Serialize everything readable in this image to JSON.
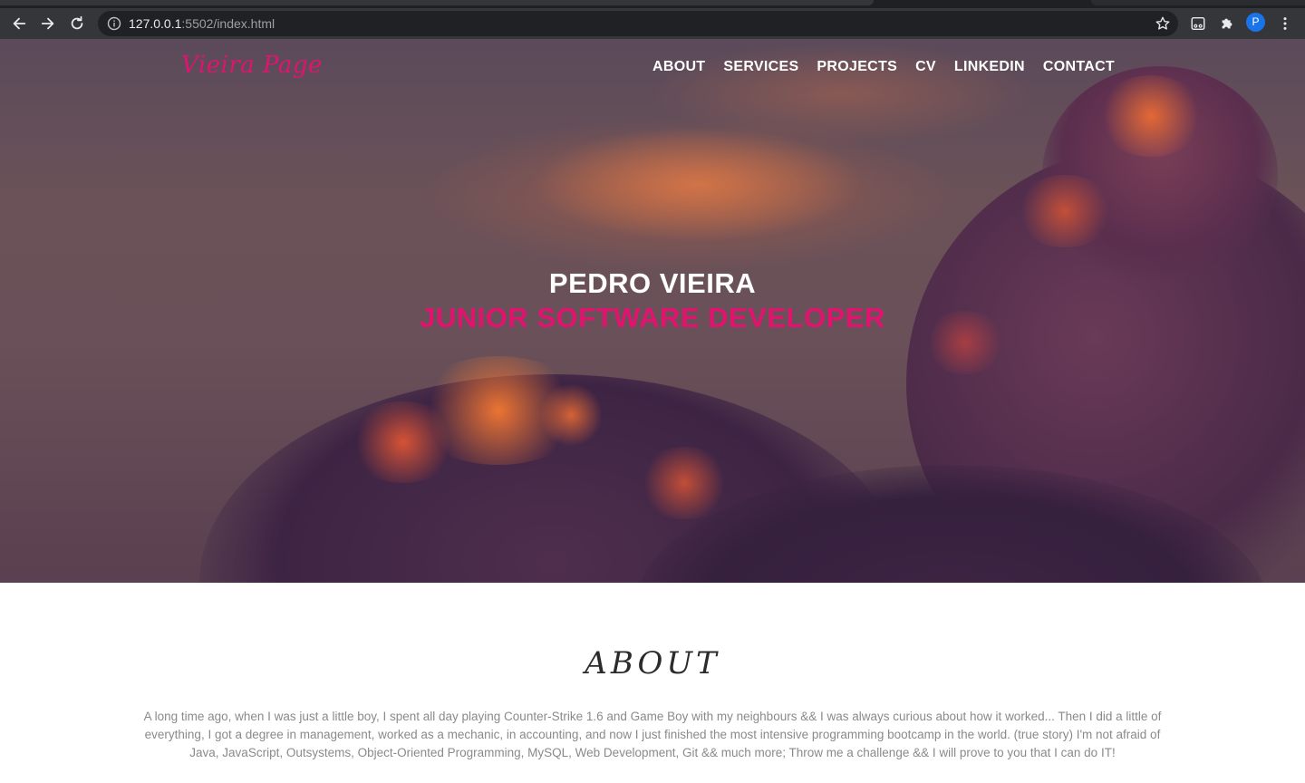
{
  "browser": {
    "url_host": "127.0.0.1",
    "url_rest": ":5502/index.html",
    "profile_initial": "P",
    "icons": [
      "back-icon",
      "forward-icon",
      "reload-icon",
      "info-icon",
      "star-icon",
      "media-icon",
      "extensions-icon",
      "menu-icon"
    ]
  },
  "header": {
    "logo": "Vieira Page",
    "nav": [
      "ABOUT",
      "SERVICES",
      "PROJECTS",
      "CV",
      "LINKEDIN",
      "CONTACT"
    ]
  },
  "hero": {
    "name": "PEDRO VIEIRA",
    "role": "JUNIOR SOFTWARE DEVELOPER"
  },
  "about": {
    "title": "ABOUT",
    "text": "A long time ago, when I was just a little boy, I spent all day playing Counter-Strike 1.6 and Game Boy with my neighbours && I was always curious about how it worked... Then I did a little of everything, I got a degree in management, worked as a mechanic, in accounting, and now I just finished the most intensive programming bootcamp in the world. (true story) I'm not afraid of Java, JavaScript, Outsystems, Object-Oriented Programming, MySQL, Web Development, Git && much more; Throw me a challenge && I will prove to you that I can do IT!"
  },
  "colors": {
    "accent": "#e0146f",
    "chrome": "#35363a",
    "omnibox": "#202124"
  }
}
